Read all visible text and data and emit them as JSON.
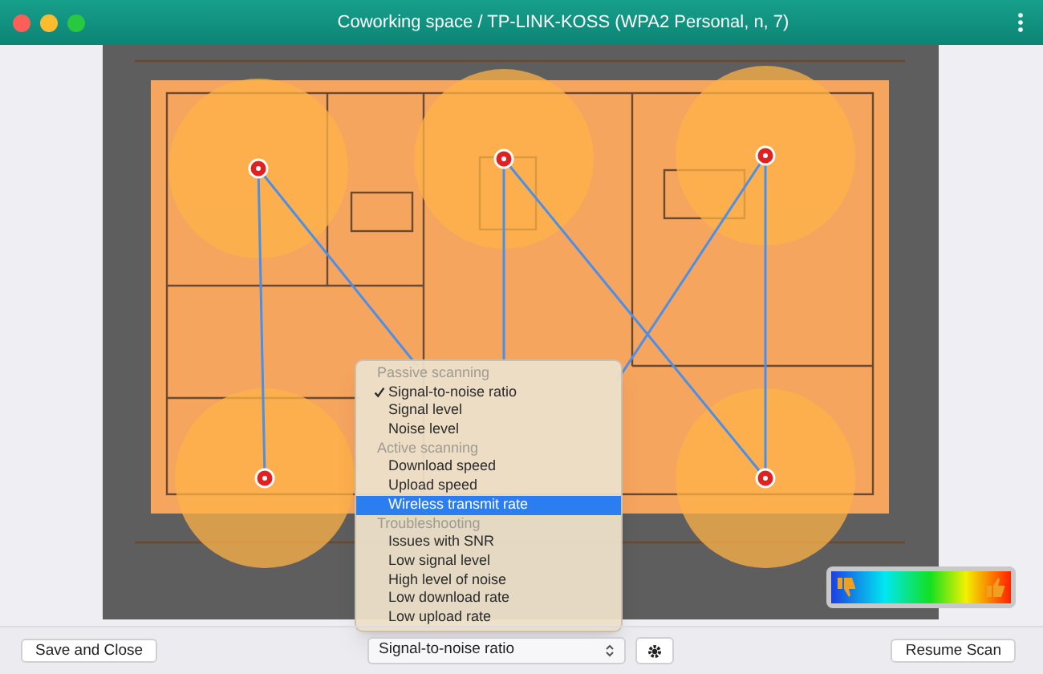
{
  "window": {
    "title": "Coworking space / TP-LINK-KOSS (WPA2 Personal, n, 7)"
  },
  "menu": [
    {
      "kind": "header",
      "label": "Passive scanning"
    },
    {
      "kind": "option",
      "label": "Signal-to-noise ratio",
      "checked": true,
      "selected": false
    },
    {
      "kind": "option",
      "label": "Signal level",
      "checked": false,
      "selected": false
    },
    {
      "kind": "option",
      "label": "Noise level",
      "checked": false,
      "selected": false
    },
    {
      "kind": "header",
      "label": "Active scanning"
    },
    {
      "kind": "option",
      "label": "Download speed",
      "checked": false,
      "selected": false
    },
    {
      "kind": "option",
      "label": "Upload speed",
      "checked": false,
      "selected": false
    },
    {
      "kind": "option",
      "label": "Wireless transmit rate",
      "checked": false,
      "selected": true
    },
    {
      "kind": "header",
      "label": "Troubleshooting"
    },
    {
      "kind": "option",
      "label": "Issues with SNR",
      "checked": false,
      "selected": false
    },
    {
      "kind": "option",
      "label": "Low signal level",
      "checked": false,
      "selected": false
    },
    {
      "kind": "option",
      "label": "High level of noise",
      "checked": false,
      "selected": false
    },
    {
      "kind": "option",
      "label": "Low download rate",
      "checked": false,
      "selected": false
    },
    {
      "kind": "option",
      "label": "Low upload rate",
      "checked": false,
      "selected": false
    }
  ],
  "select": {
    "value": "Signal-to-noise ratio"
  },
  "buttons": {
    "save": "Save and Close",
    "resume": "Resume Scan"
  }
}
